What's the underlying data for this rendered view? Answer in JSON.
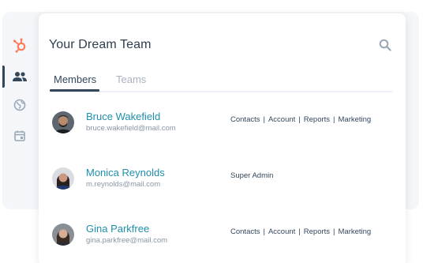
{
  "colors": {
    "brand": "#ff7a59",
    "link": "#1f8fab",
    "text_dark": "#2d3e50",
    "muted": "#a8b3c1"
  },
  "rail": {
    "items": [
      {
        "icon": "hubspot-logo-icon",
        "active": false
      },
      {
        "icon": "people-icon",
        "active": true
      },
      {
        "icon": "globe-icon",
        "active": false
      },
      {
        "icon": "calendar-icon",
        "active": false
      }
    ]
  },
  "card": {
    "title": "Your Dream Team",
    "search_icon": "search-icon"
  },
  "tabs": [
    {
      "label": "Members",
      "active": true
    },
    {
      "label": "Teams",
      "active": false
    }
  ],
  "members": [
    {
      "name": "Bruce Wakefield",
      "email": "bruce.wakefield@mail.com",
      "roles": [
        "Contacts",
        "Account",
        "Reports",
        "Marketing"
      ]
    },
    {
      "name": "Monica Reynolds",
      "email": "m.reynolds@mail.com",
      "roles": [
        "Super Admin"
      ]
    },
    {
      "name": "Gina Parkfree",
      "email": "gina.parkfree@mail.com",
      "roles": [
        "Contacts",
        "Account",
        "Reports",
        "Marketing"
      ]
    }
  ]
}
